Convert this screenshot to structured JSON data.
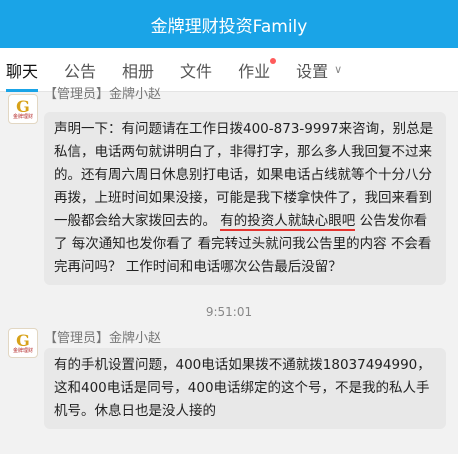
{
  "header": {
    "title": "金牌理财投资Family"
  },
  "tabs": [
    {
      "label": "聊天",
      "active": true
    },
    {
      "label": "公告"
    },
    {
      "label": "相册"
    },
    {
      "label": "文件"
    },
    {
      "label": "作业",
      "badge": true
    },
    {
      "label": "设置"
    }
  ],
  "messages": [
    {
      "sender": "【管理员】金牌小赵",
      "text_a": "声明一下：有问题请在工作日拨400-873-9997来咨询，别总是私信，电话两句就讲明白了，非得打字，那么多人我回复不过来的。还有周六周日休息别打电话，如果电话占线就等个十分八分再拨，上班时间如果没接，可能是我下楼拿快件了，我回来看到一般都会给大家拨回去的。 ",
      "text_highlight": "有的投资人就缺心眼吧",
      "text_b": "  公告发你看了  每次通知也发你看了  看完转过头就问我公告里的内容   不会看完再问吗？  工作时间和电话哪次公告最后没留？"
    },
    {
      "sender": "【管理员】金牌小赵",
      "text": "有的手机设置问题，400电话如果拨不通就拨18037494990，这和400电话是同号，400电话绑定的这个号，不是我的私人手机号。休息日也是没人接的"
    }
  ],
  "timestamp": "9:51:01",
  "avatar": {
    "glyph": "G",
    "caption": "金牌理财"
  },
  "colors": {
    "accent": "#1aa4e7",
    "badge": "#ff5b5b",
    "highlight_underline": "#e5342f"
  }
}
